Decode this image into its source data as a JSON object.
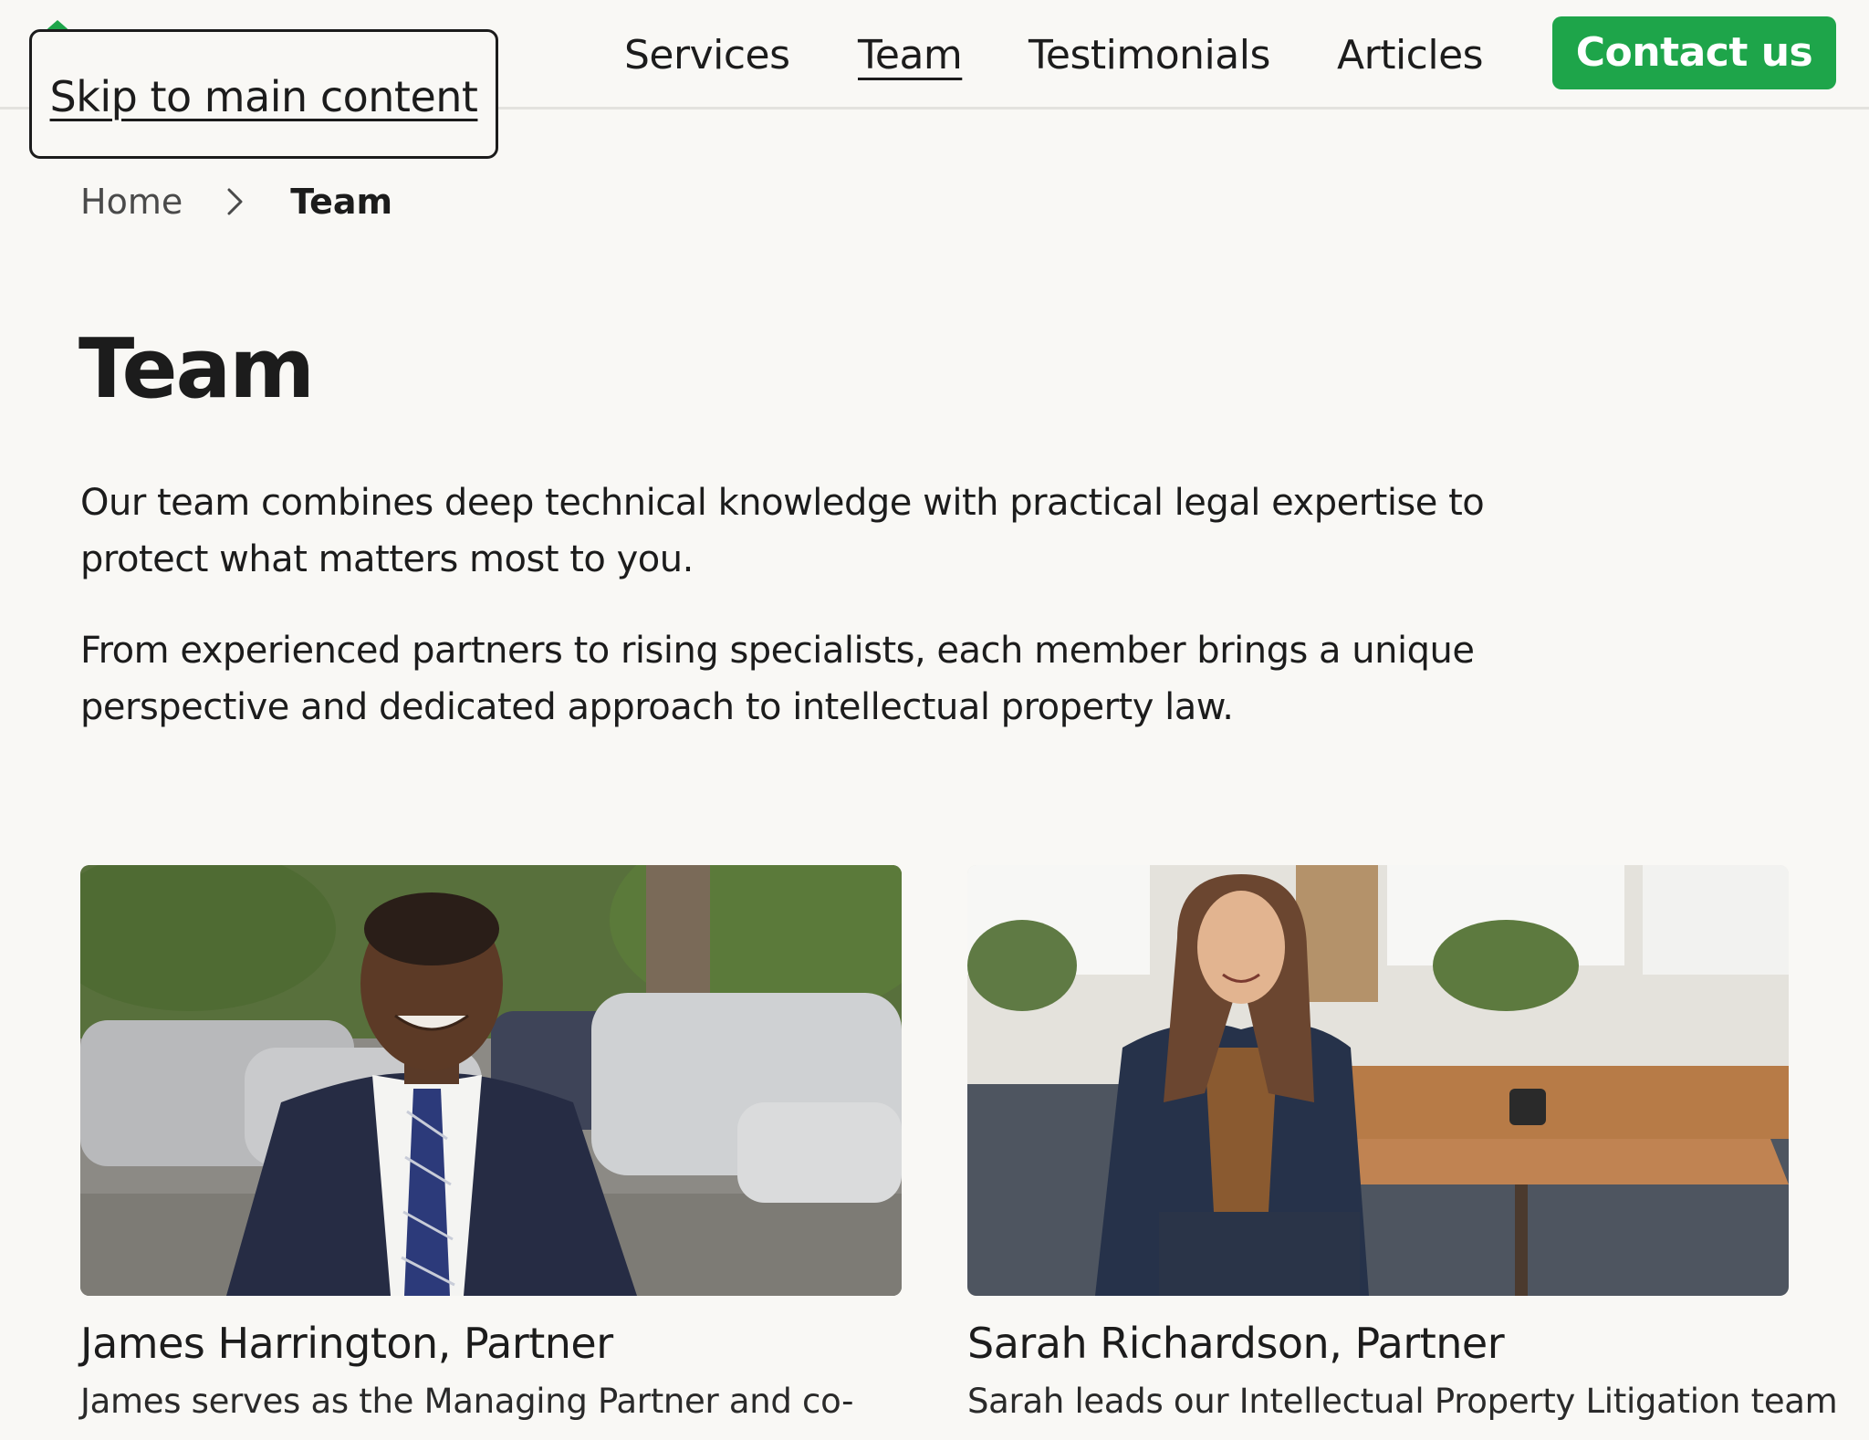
{
  "skip_link": "Skip to main content",
  "nav": {
    "items": [
      {
        "label": "Services"
      },
      {
        "label": "Team"
      },
      {
        "label": "Testimonials"
      },
      {
        "label": "Articles"
      }
    ],
    "active": "Team",
    "contact_label": "Contact us"
  },
  "breadcrumb": {
    "home": "Home",
    "current": "Team"
  },
  "page": {
    "title": "Team",
    "intro_1": "Our team combines deep technical knowledge with practical legal expertise to protect what matters most to you.",
    "intro_2": "From experienced partners to rising specialists, each member brings a unique perspective and dedicated approach to intellectual property law."
  },
  "team": [
    {
      "name": "James Harrington, Partner",
      "bio": "James serves as the Managing Partner and co-"
    },
    {
      "name": "Sarah Richardson, Partner",
      "bio": "Sarah leads our Intellectual Property Litigation team"
    }
  ],
  "colors": {
    "accent": "#1ea54a",
    "background": "#f9f8f5",
    "text": "#1c1c1c"
  }
}
